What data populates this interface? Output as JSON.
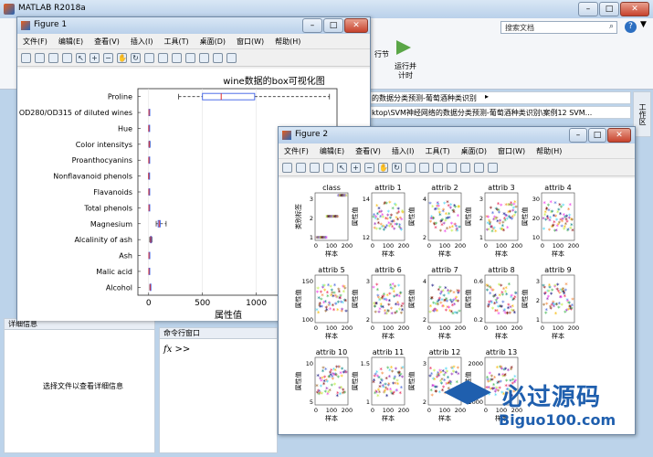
{
  "matlab": {
    "title": "MATLAB R2018a",
    "search_placeholder": "搜索文档",
    "toolbar_section_label": "行节",
    "run_advance_label1": "运行并",
    "run_advance_label2": "计时",
    "path_text1": "的数据分类预测-葡萄酒种类识别",
    "path_text2": "ktop\\SVM神经网络的数据分类预测-葡萄酒种类识别\\案例12 SVM...",
    "workspace_label": "工作区",
    "details_title": "详细信息",
    "details_msg": "选择文件以查看详细信息",
    "cmd_title": "命令行窗口",
    "cmd_prompt": "fx >>",
    "watermark_main": "必过源码",
    "watermark_url": "Biguo100.com"
  },
  "figure1": {
    "title": "Figure 1",
    "menu": [
      "文件(F)",
      "编辑(E)",
      "查看(V)",
      "插入(I)",
      "工具(T)",
      "桌面(D)",
      "窗口(W)",
      "帮助(H)"
    ],
    "chart_data": {
      "type": "boxplot",
      "title": "wine数据的box可视化图",
      "xlabel": "属性值",
      "xlim": [
        -100,
        1750
      ],
      "xticks": [
        0,
        500,
        1000
      ],
      "categories": [
        "Proline",
        "OD280/OD315 of diluted wines",
        "Hue",
        "Color intensitys",
        "Proanthocyanins",
        "Nonflavanoid phenols",
        "Flavanoids",
        "Total phenols",
        "Magnesium",
        "Alcalinity of ash",
        "Ash",
        "Malic acid",
        "Alcohol"
      ],
      "boxes": [
        {
          "min": 278,
          "q1": 500,
          "median": 674,
          "q3": 985,
          "max": 1680
        },
        {
          "min": 1.3,
          "q1": 1.9,
          "median": 2.8,
          "q3": 3.2,
          "max": 4.0
        },
        {
          "min": 0.5,
          "q1": 0.8,
          "median": 1.0,
          "q3": 1.1,
          "max": 1.7
        },
        {
          "min": 1.3,
          "q1": 3.2,
          "median": 4.7,
          "q3": 6.2,
          "max": 13
        },
        {
          "min": 0.4,
          "q1": 1.2,
          "median": 1.6,
          "q3": 2.0,
          "max": 3.6
        },
        {
          "min": 0.1,
          "q1": 0.3,
          "median": 0.3,
          "q3": 0.4,
          "max": 0.7
        },
        {
          "min": 0.3,
          "q1": 1.2,
          "median": 2.1,
          "q3": 2.9,
          "max": 5.1
        },
        {
          "min": 1.0,
          "q1": 1.7,
          "median": 2.4,
          "q3": 2.8,
          "max": 3.9
        },
        {
          "min": 70,
          "q1": 88,
          "median": 98,
          "q3": 107,
          "max": 162
        },
        {
          "min": 10,
          "q1": 17,
          "median": 19,
          "q3": 21,
          "max": 30
        },
        {
          "min": 1.4,
          "q1": 2.2,
          "median": 2.4,
          "q3": 2.6,
          "max": 3.2
        },
        {
          "min": 0.7,
          "q1": 1.6,
          "median": 1.9,
          "q3": 3.1,
          "max": 5.8
        },
        {
          "min": 11,
          "q1": 12.4,
          "median": 13.1,
          "q3": 13.7,
          "max": 14.8
        }
      ]
    }
  },
  "figure2": {
    "title": "Figure 2",
    "menu": [
      "文件(F)",
      "编辑(E)",
      "查看(V)",
      "插入(I)",
      "工具(T)",
      "桌面(D)",
      "窗口(W)",
      "帮助(H)"
    ],
    "chart_data": {
      "type": "scatter",
      "xlabel": "样本",
      "ylabel": "属性值",
      "class_ylabel": "类别标签",
      "subplots": [
        {
          "title": "class",
          "ylim": [
            1,
            3
          ],
          "yticks": [
            "1",
            "2",
            "3"
          ]
        },
        {
          "title": "attrib 1",
          "ylim": [
            11,
            15
          ],
          "yticks": [
            "12",
            "14"
          ]
        },
        {
          "title": "attrib 2",
          "ylim": [
            0,
            6
          ],
          "yticks": [
            "2",
            "4"
          ]
        },
        {
          "title": "attrib 3",
          "ylim": [
            1,
            3
          ],
          "yticks": [
            "1",
            "2",
            "3"
          ]
        },
        {
          "title": "attrib 4",
          "ylim": [
            10,
            30
          ],
          "yticks": [
            "10",
            "20",
            "30"
          ]
        },
        {
          "title": "attrib 5",
          "ylim": [
            50,
            150
          ],
          "yticks": [
            "100",
            "150"
          ]
        },
        {
          "title": "attrib 6",
          "ylim": [
            1,
            4
          ],
          "yticks": [
            "2",
            "3"
          ]
        },
        {
          "title": "attrib 7",
          "ylim": [
            0,
            5
          ],
          "yticks": [
            "2",
            "4"
          ]
        },
        {
          "title": "attrib 8",
          "ylim": [
            0,
            0.8
          ],
          "yticks": [
            "0.2",
            "0.6"
          ]
        },
        {
          "title": "attrib 9",
          "ylim": [
            0,
            4
          ],
          "yticks": [
            "1",
            "2",
            "3"
          ]
        },
        {
          "title": "attrib 10",
          "ylim": [
            0,
            15
          ],
          "yticks": [
            "5",
            "10"
          ]
        },
        {
          "title": "attrib 11",
          "ylim": [
            0.5,
            2
          ],
          "yticks": [
            "1",
            "1.5"
          ]
        },
        {
          "title": "attrib 12",
          "ylim": [
            1,
            4
          ],
          "yticks": [
            "2",
            "3"
          ]
        },
        {
          "title": "attrib 13",
          "ylim": [
            0,
            2000
          ],
          "yticks": [
            "1000",
            "2000"
          ]
        }
      ],
      "xticks": [
        "0",
        "100",
        "200"
      ]
    }
  }
}
